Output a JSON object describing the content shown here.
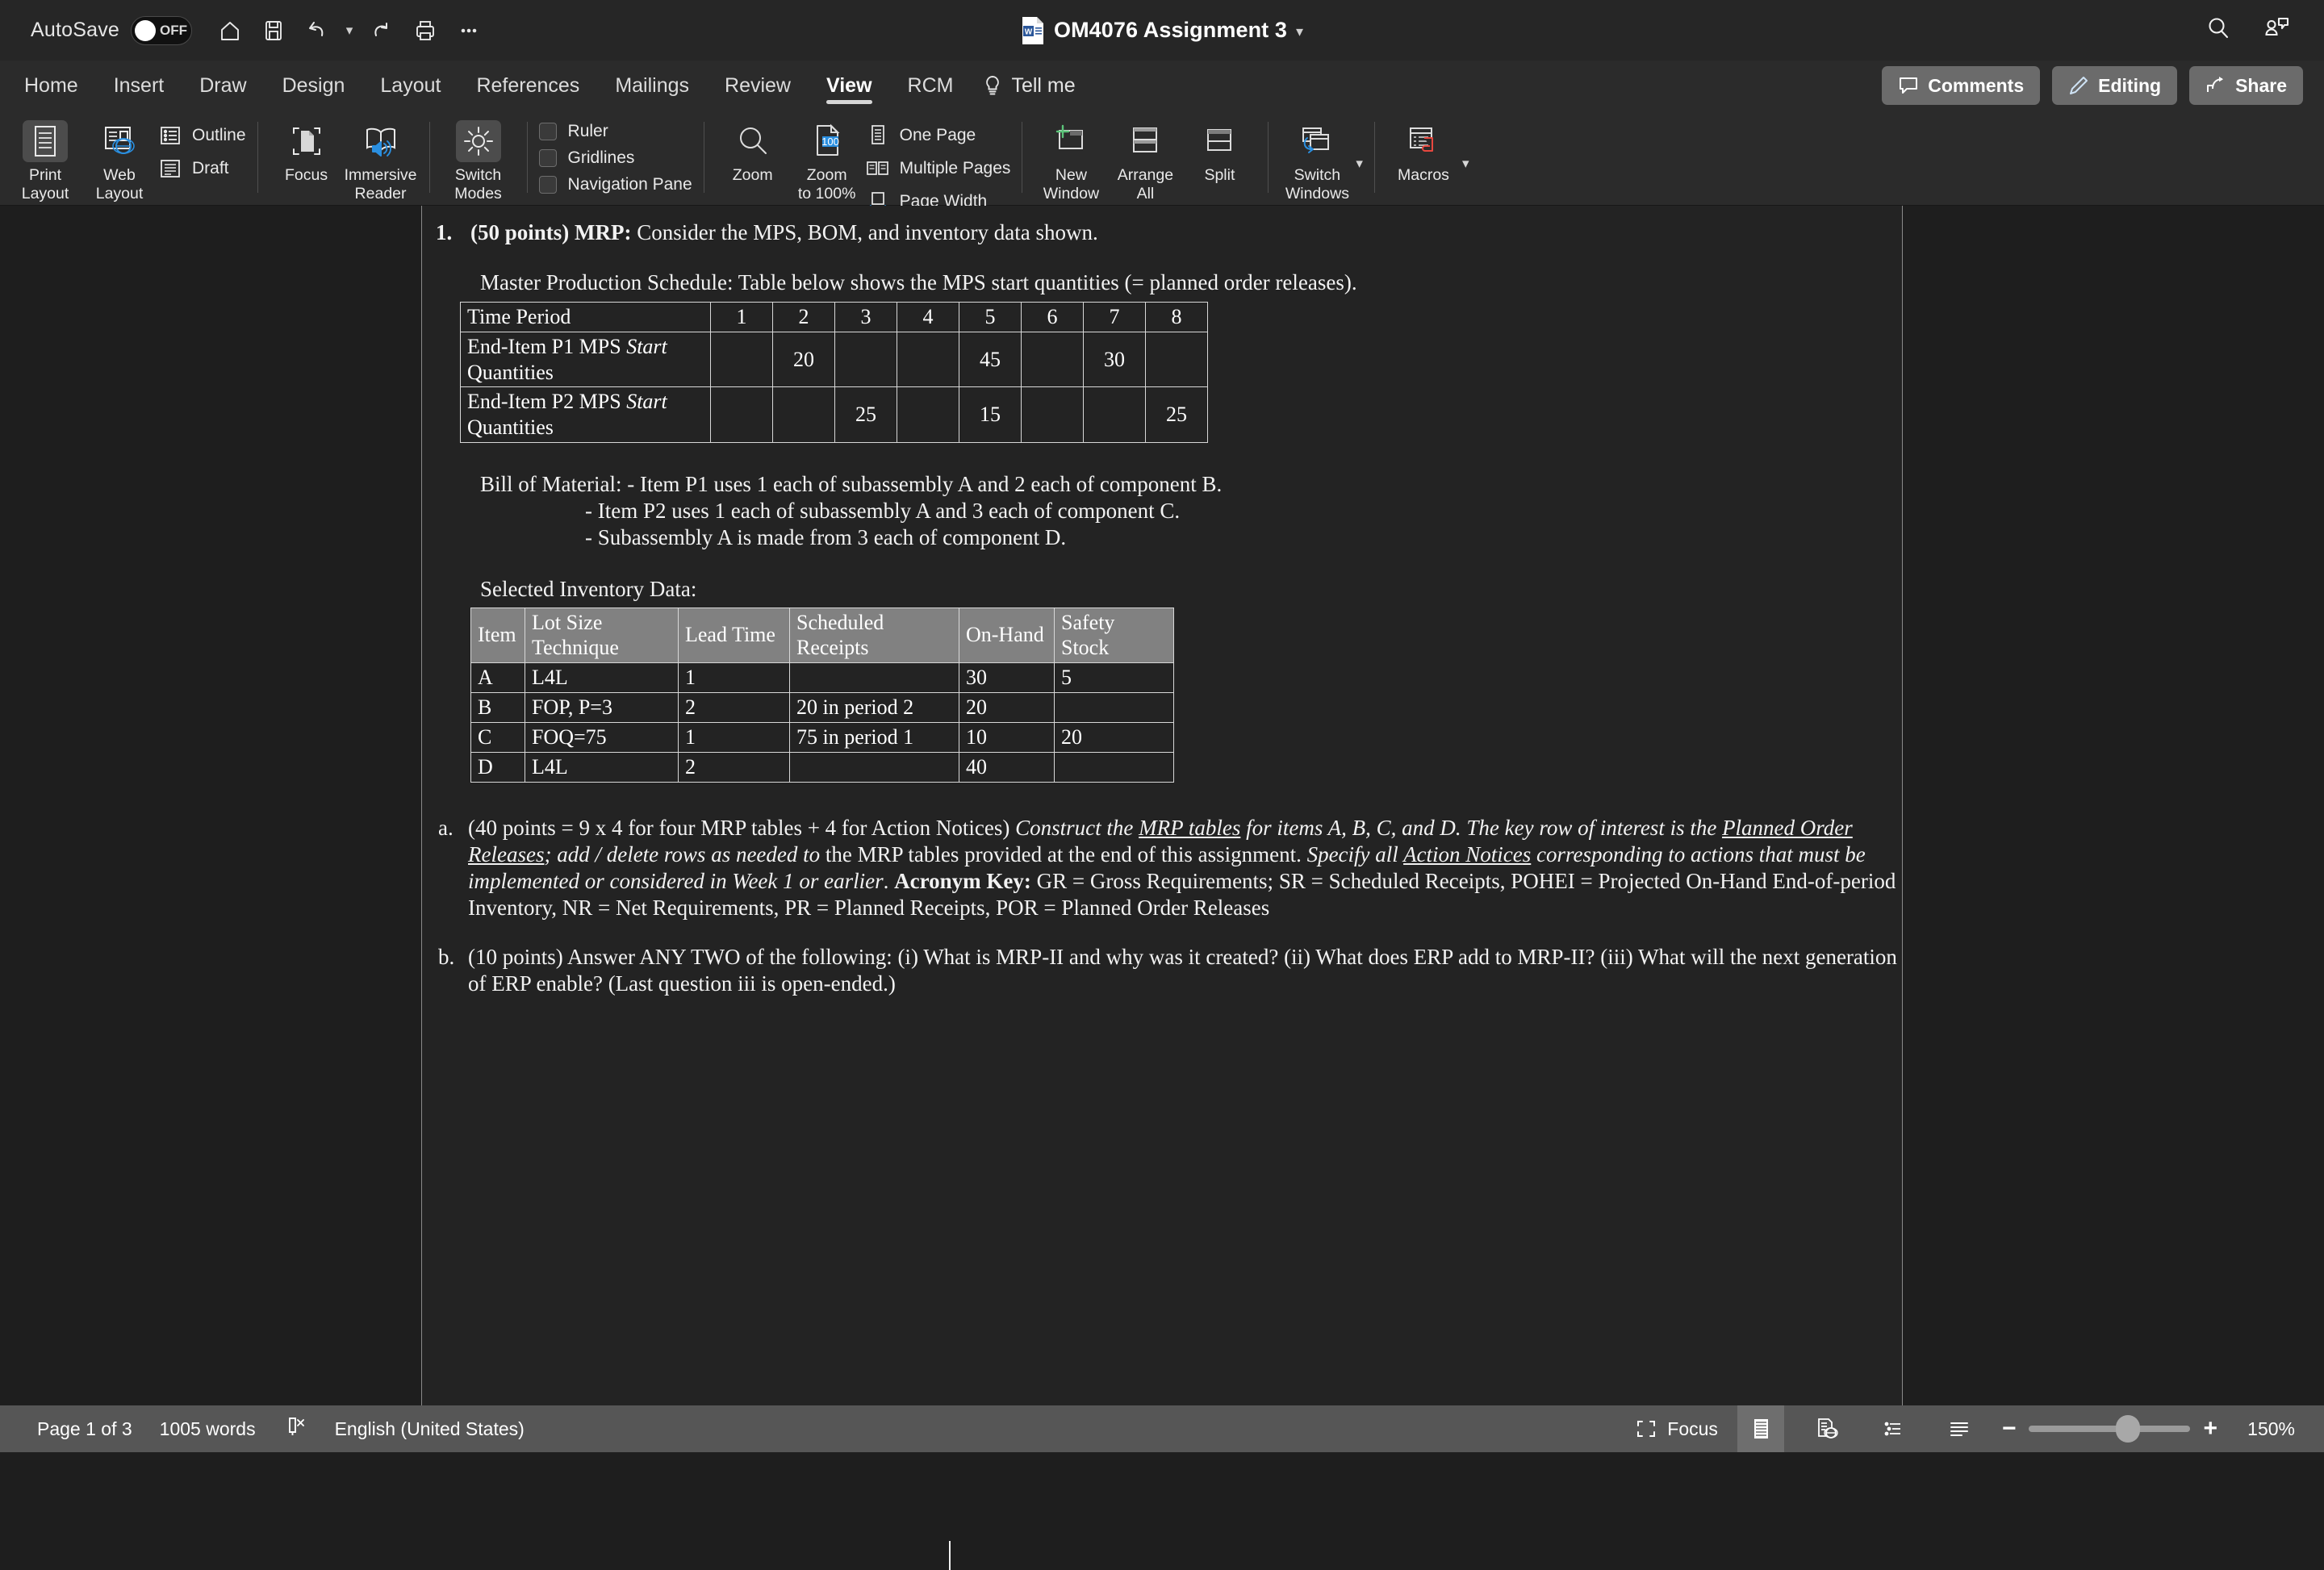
{
  "titlebar": {
    "autosave_label": "AutoSave",
    "autosave_state": "OFF",
    "doc_title": "OM4076 Assignment 3",
    "quick_access": [
      {
        "name": "home-icon",
        "tooltip": "Home"
      },
      {
        "name": "save-icon",
        "tooltip": "Save"
      },
      {
        "name": "undo-icon",
        "tooltip": "Undo"
      },
      {
        "name": "redo-icon",
        "tooltip": "Redo"
      },
      {
        "name": "print-icon",
        "tooltip": "Print"
      },
      {
        "name": "more-icon",
        "tooltip": "More"
      }
    ],
    "search_icon": "search-icon",
    "account_icon": "user-comment-icon"
  },
  "tabs": [
    {
      "label": "Home",
      "active": false
    },
    {
      "label": "Insert",
      "active": false
    },
    {
      "label": "Draw",
      "active": false
    },
    {
      "label": "Design",
      "active": false
    },
    {
      "label": "Layout",
      "active": false
    },
    {
      "label": "References",
      "active": false
    },
    {
      "label": "Mailings",
      "active": false
    },
    {
      "label": "Review",
      "active": false
    },
    {
      "label": "View",
      "active": true
    },
    {
      "label": "RCM",
      "active": false
    }
  ],
  "tellme": {
    "label": "Tell me",
    "icon": "lightbulb-icon"
  },
  "tab_actions": {
    "comments": "Comments",
    "editing": "Editing",
    "share": "Share"
  },
  "ribbon": {
    "views": {
      "print_layout": "Print\nLayout",
      "print_layout_l1": "Print",
      "print_layout_l2": "Layout",
      "web_layout_l1": "Web",
      "web_layout_l2": "Layout",
      "outline": "Outline",
      "draft": "Draft"
    },
    "immersive": {
      "focus": "Focus",
      "immersive_l1": "Immersive",
      "immersive_l2": "Reader"
    },
    "switch_modes": {
      "l1": "Switch",
      "l2": "Modes"
    },
    "show": {
      "ruler": "Ruler",
      "gridlines": "Gridlines",
      "navigation_pane": "Navigation Pane"
    },
    "zoom": {
      "zoom": "Zoom",
      "zoom_to_100_l1": "Zoom",
      "zoom_to_100_l2": "to 100%",
      "badge": "100",
      "one_page": "One Page",
      "multiple_pages": "Multiple Pages",
      "page_width": "Page Width"
    },
    "window": {
      "new_window_l1": "New",
      "new_window_l2": "Window",
      "arrange_all_l1": "Arrange",
      "arrange_all_l2": "All",
      "split": "Split",
      "switch_windows_l1": "Switch",
      "switch_windows_l2": "Windows"
    },
    "macros": {
      "label": "Macros"
    }
  },
  "document": {
    "q1": {
      "number": "1.",
      "bold_lead": "(50 points) MRP:",
      "rest": " Consider the MPS, BOM, and inventory data shown."
    },
    "mps_intro": "Master Production Schedule: Table below shows the MPS start quantities (= planned order releases).",
    "mps_table": {
      "row_labels": [
        "Time Period",
        "End-Item P1 MPS ",
        "End-Item P2 MPS "
      ],
      "row1_label": "Time Period",
      "row2_label_a": "End-Item P1 MPS ",
      "row2_label_i": "Start",
      "row2_label_b": " Quantities",
      "row3_label_a": "End-Item P2 MPS ",
      "row3_label_i": "Start",
      "row3_label_b": " Quantities",
      "periods": [
        "1",
        "2",
        "3",
        "4",
        "5",
        "6",
        "7",
        "8"
      ],
      "p1": [
        "",
        "20",
        "",
        "",
        "45",
        "",
        "30",
        ""
      ],
      "p2": [
        "",
        "",
        "25",
        "",
        "15",
        "",
        "",
        "25"
      ]
    },
    "bom": {
      "line1": "Bill of Material: - Item P1 uses 1 each of subassembly A and 2 each of component B.",
      "line2": "- Item P2 uses 1 each of subassembly A and 3 each of component C.",
      "line3": "- Subassembly A is made from 3 each of component D."
    },
    "inventory_label": "Selected Inventory Data:",
    "inventory_table": {
      "headers": [
        "Item",
        "Lot Size Technique",
        "Lead Time",
        "Scheduled Receipts",
        "On-Hand",
        "Safety Stock"
      ],
      "rows": [
        [
          "A",
          "L4L",
          "1",
          "",
          "30",
          "5"
        ],
        [
          "B",
          "FOP, P=3",
          "2",
          "20 in period 2",
          "20",
          ""
        ],
        [
          "C",
          "FOQ=75",
          "1",
          "75 in period 1",
          "10",
          "20"
        ],
        [
          "D",
          "L4L",
          "2",
          "",
          "40",
          ""
        ]
      ]
    },
    "part_a": {
      "marker": "a.",
      "seg1": " (40 points = 9 x 4 for four MRP tables + 4 for Action Notices) ",
      "seg2_i": "Construct the ",
      "seg3_iu": "MRP tables",
      "seg4_i": " for items A, B, C, and D. The key row of interest is the ",
      "seg5_iu": "Planned Order Releases",
      "seg6_i": "; add / delete rows as needed to",
      "seg7": " the MRP tables provided at the end of this assignment. ",
      "seg8_i": "Specify all ",
      "seg9_iu": "Action Notices",
      "seg10_i": " corresponding to actions that must be implemented or considered in Week 1 or earlier",
      "seg11": ". ",
      "seg12_b": "Acronym Key:",
      "seg13": " GR = Gross Requirements; SR = Scheduled Receipts, POHEI = Projected On-Hand End-of-period Inventory, NR = Net Requirements, PR = Planned Receipts, POR = Planned Order Releases"
    },
    "part_b": {
      "marker": "b.",
      "text": "(10 points) Answer ANY TWO of the following: (i) What is MRP-II and why was it created? (ii) What does ERP add to MRP-II? (iii) What will the next generation of ERP enable? (Last question iii is open-ended.)"
    }
  },
  "statusbar": {
    "page": "Page 1 of 3",
    "words": "1005 words",
    "proofing_icon": "proofing-errors-icon",
    "language": "English (United States)",
    "focus": "Focus",
    "zoom_percent": "150%",
    "zoom_out": "−",
    "zoom_in": "+",
    "view_icons": [
      "print-layout-view-icon",
      "web-layout-view-icon",
      "outline-view-icon",
      "draft-view-icon"
    ]
  },
  "colors": {
    "titlebar_bg": "#262626",
    "ribbon_bg": "#2b2b2b",
    "page_bg": "#232323",
    "statusbar_bg": "#565656",
    "accent_blue": "#2a8fe0",
    "accent_green": "#5cc47a",
    "accent_red": "#e8483f",
    "text": "#f2f2f2"
  }
}
